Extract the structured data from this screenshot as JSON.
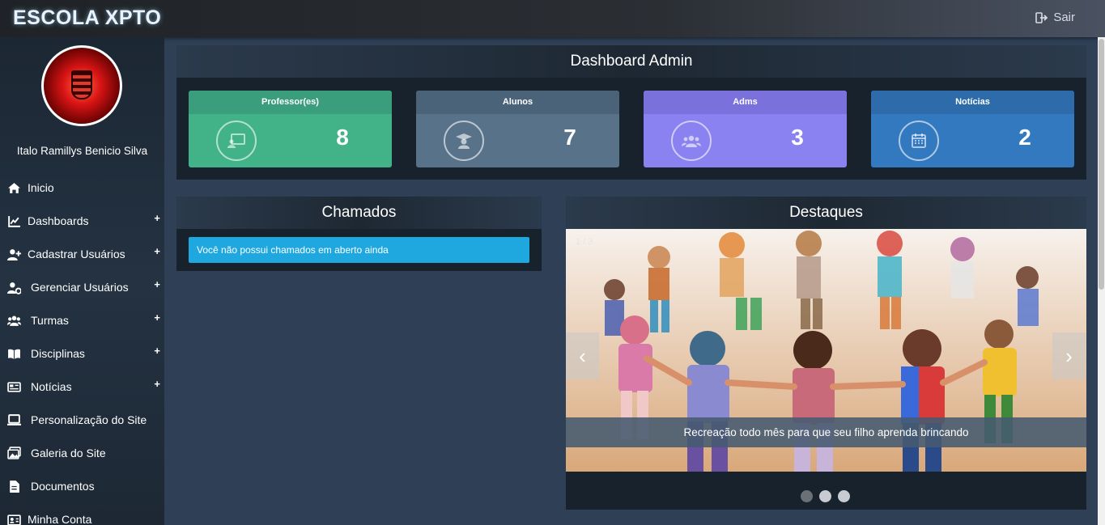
{
  "header": {
    "brand": "ESCOLA XPTO",
    "logout_label": "Sair"
  },
  "sidebar": {
    "user_name": "Italo Ramillys Benicio Silva",
    "items": [
      {
        "label": "Inicio",
        "icon": "home-icon",
        "expandable": false
      },
      {
        "label": "Dashboards",
        "icon": "chart-line-icon",
        "expandable": true
      },
      {
        "label": "Cadastrar Usuários",
        "icon": "user-plus-icon",
        "expandable": true
      },
      {
        "label": "Gerenciar Usuários",
        "icon": "user-gear-icon",
        "expandable": true
      },
      {
        "label": "Turmas",
        "icon": "users-icon",
        "expandable": true
      },
      {
        "label": "Disciplinas",
        "icon": "book-icon",
        "expandable": true
      },
      {
        "label": "Notícias",
        "icon": "newspaper-icon",
        "expandable": true
      },
      {
        "label": "Personalização do Site",
        "icon": "laptop-icon",
        "expandable": false
      },
      {
        "label": "Galeria do Site",
        "icon": "images-icon",
        "expandable": false
      },
      {
        "label": "Documentos",
        "icon": "file-icon",
        "expandable": false
      },
      {
        "label": "Minha Conta",
        "icon": "id-card-icon",
        "expandable": false
      }
    ],
    "plus_symbol": "+"
  },
  "dashboard": {
    "title": "Dashboard Admin",
    "cards": [
      {
        "label": "Professor(es)",
        "value": "8",
        "icon": "chalkboard-teacher-icon",
        "head_color": "#3a9d7b",
        "body_color": "#42b389"
      },
      {
        "label": "Alunos",
        "value": "7",
        "icon": "graduate-icon",
        "head_color": "#4a6378",
        "body_color": "#587389"
      },
      {
        "label": "Adms",
        "value": "3",
        "icon": "users-group-icon",
        "head_color": "#7a71dc",
        "body_color": "#8a82f0"
      },
      {
        "label": "Notícias",
        "value": "2",
        "icon": "calendar-icon",
        "head_color": "#2d6bab",
        "body_color": "#3379bf"
      }
    ]
  },
  "chamados": {
    "title": "Chamados",
    "alert": "Você não possui chamados em aberto ainda"
  },
  "destaques": {
    "title": "Destaques",
    "counter": "1 / 3",
    "caption": "Recreação todo mês para que seu filho aprenda brincando",
    "prev_symbol": "‹",
    "next_symbol": "›",
    "slide_count": 3,
    "active_slide": 1
  }
}
